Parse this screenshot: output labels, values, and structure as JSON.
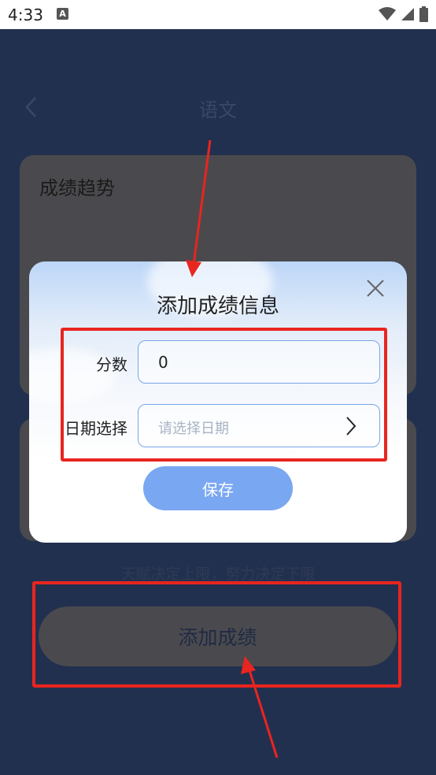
{
  "status_bar": {
    "time": "4:33",
    "notification_icon_letter": "A"
  },
  "nav": {
    "title": "语文"
  },
  "trend_card": {
    "title": "成绩趋势"
  },
  "motto": "天赋决定上限，努力决定下限",
  "add_button": {
    "label": "添加成绩"
  },
  "dialog": {
    "title": "添加成绩信息",
    "score_label": "分数",
    "score_value": "0",
    "date_label": "日期选择",
    "date_placeholder": "请选择日期",
    "save_label": "保存"
  },
  "colors": {
    "background": "#22304f",
    "accent_blue": "#7aa7f2",
    "annotation_red": "#e8251f"
  }
}
